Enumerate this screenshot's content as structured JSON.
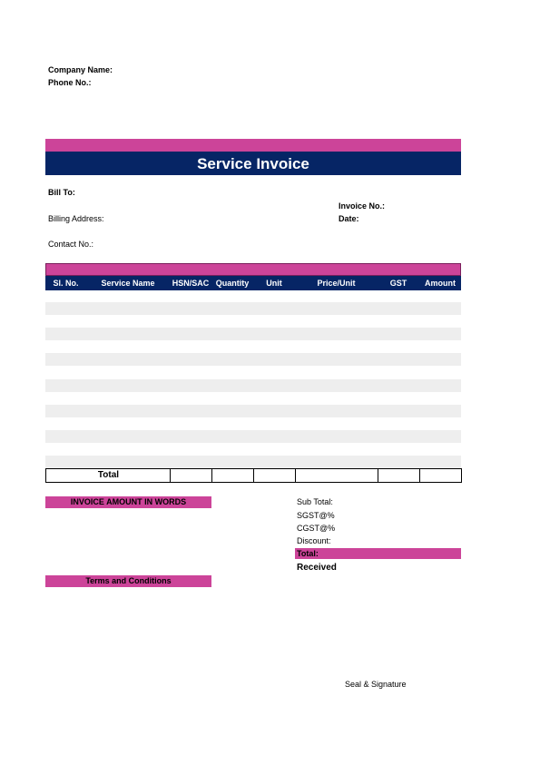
{
  "colors": {
    "pink": "#cc4499",
    "navy": "#062565",
    "stripe": "#eeeeee"
  },
  "company": {
    "name_label": "Company Name:",
    "phone_label": "Phone No.:"
  },
  "header": {
    "title": "Service Invoice"
  },
  "billing": {
    "bill_to_label": "Bill To:",
    "billing_address_label": "Billing Address:",
    "contact_label": "Contact No.:",
    "invoice_no_label": "Invoice No.:",
    "date_label": "Date:"
  },
  "table": {
    "columns": [
      "Sl. No.",
      "Service Name",
      "HSN/SAC",
      "Quantity",
      "Unit",
      "Price/Unit",
      "GST",
      "Amount"
    ],
    "total_label": "Total"
  },
  "amount_words": {
    "label": "INVOICE AMOUNT IN WORDS"
  },
  "terms": {
    "label": "Terms and Conditions"
  },
  "summary": {
    "sub_total_label": "Sub Total:",
    "sgst_label": "SGST@%",
    "cgst_label": "CGST@%",
    "discount_label": "Discount:",
    "total_label": "Total:",
    "received_label": "Received"
  },
  "footer": {
    "seal_label": "Seal & Signature"
  }
}
